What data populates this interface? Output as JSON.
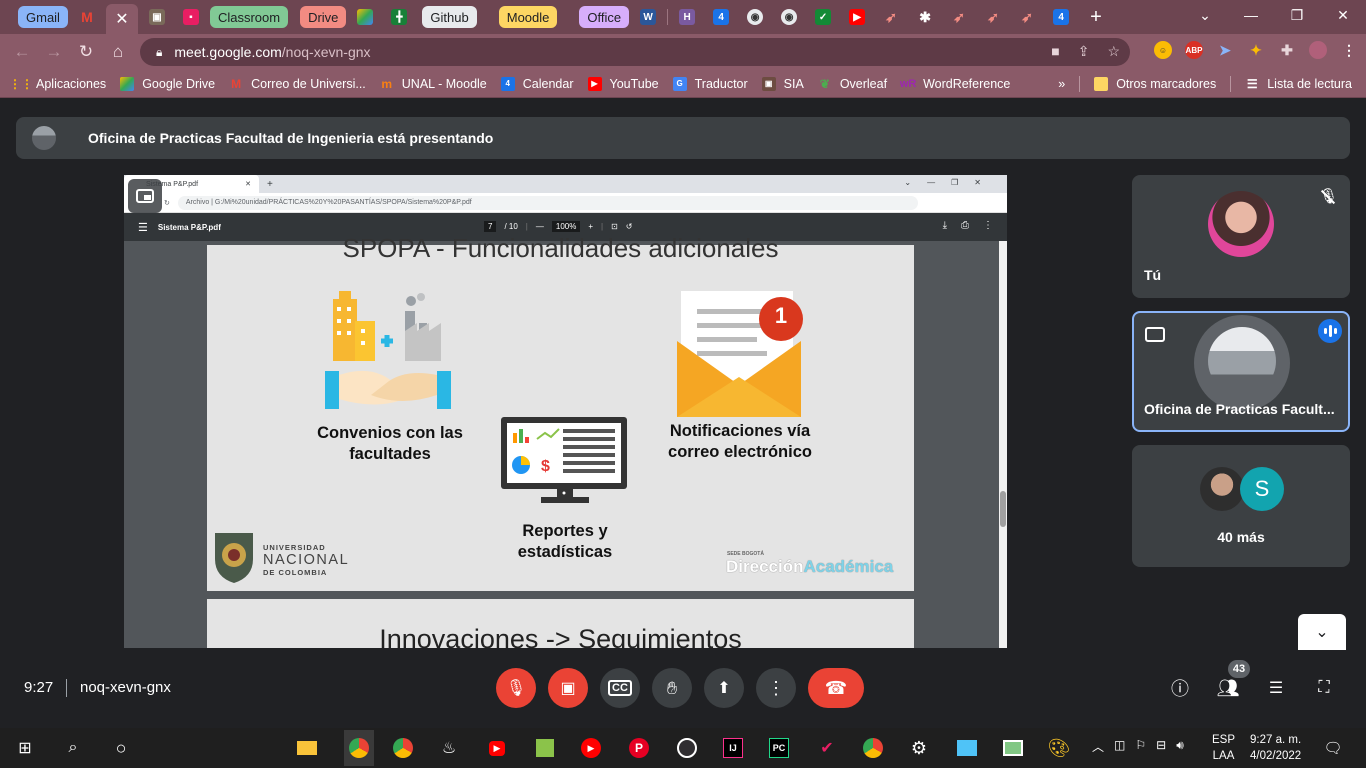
{
  "browser": {
    "tabs": [
      {
        "label": "Gmail",
        "color": "#8ab4f8"
      },
      {
        "label": "Classroom",
        "color": "#81c995"
      },
      {
        "label": "Drive",
        "color": "#f28b82"
      },
      {
        "label": "Github",
        "color": "#e8eaed"
      },
      {
        "label": "Moodle",
        "color": "#fdd663"
      },
      {
        "label": "Office",
        "color": "#d7aefb"
      }
    ],
    "active_tab_close": "✕",
    "new_tab": "+",
    "url_host": "meet.google.com",
    "url_path": "/noq-xevn-gnx"
  },
  "bookmarks": {
    "items": [
      {
        "label": "Aplicaciones"
      },
      {
        "label": "Google Drive"
      },
      {
        "label": "Correo de Universi..."
      },
      {
        "label": "UNAL - Moodle"
      },
      {
        "label": "Calendar"
      },
      {
        "label": "YouTube"
      },
      {
        "label": "Traductor"
      },
      {
        "label": "SIA"
      },
      {
        "label": "Overleaf"
      },
      {
        "label": "WordReference"
      }
    ],
    "more": "»",
    "otros": "Otros marcadores",
    "lectura": "Lista de lectura"
  },
  "meet": {
    "presenting_text": "Oficina de Practicas Facultad de Ingenieria está presentando",
    "tiles": {
      "self_name": "Tú",
      "presenter_name": "Oficina de Practicas Facult...",
      "others_initial": "S",
      "others_count": "40 más"
    },
    "clock": "9:27",
    "meeting_code": "noq-xevn-gnx",
    "participants_badge": "43"
  },
  "shared_screen": {
    "tab_title": "Sistema P&P.pdf",
    "address": "Archivo  |  G:/Mi%20unidad/PRÁCTICAS%20Y%20PASANTÍAS/SPOPA/Sistema%20P&P.pdf",
    "pdf_title": "Sistema P&P.pdf",
    "page_current": "7",
    "page_total": "/ 10",
    "zoom": "100%",
    "slide_heading": "SPOPA - Funcionalidades adicionales",
    "item1": "Convenios con las facultades",
    "item2": "Reportes y estadísticas",
    "item3": "Notificaciones vía correo electrónico",
    "notification_count": "1",
    "logo_univ": "UNIVERSIDAD",
    "logo_nacional": "NACIONAL",
    "logo_colombia": "DE COLOMBIA",
    "logo_sede": "SEDE BOGOTÁ",
    "logo_direccion": "Dirección",
    "logo_academica": "Académica",
    "next_slide_title": "Innovaciones -> Seguimientos"
  },
  "taskbar": {
    "lang1": "ESP",
    "lang2": "LAA",
    "time": "9:27 a. m.",
    "date": "4/02/2022"
  }
}
